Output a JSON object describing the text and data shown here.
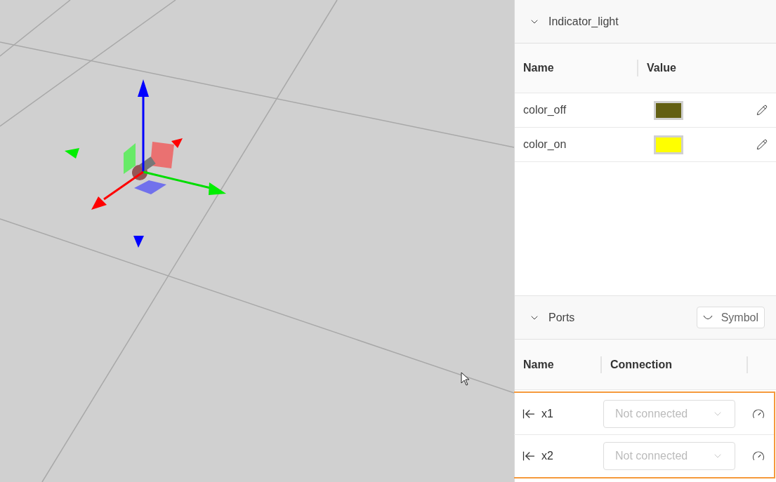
{
  "properties": {
    "title": "Indicator_light",
    "expanded": true,
    "columns": [
      "Name",
      "Value"
    ],
    "rows": [
      {
        "name": "color_off",
        "color": "#636013"
      },
      {
        "name": "color_on",
        "color": "#ffff00"
      }
    ]
  },
  "ports": {
    "title": "Ports",
    "expanded": true,
    "symbol_button": "Symbol",
    "columns": [
      "Name",
      "Connection"
    ],
    "highlighted": true,
    "rows": [
      {
        "name": "x1",
        "placeholder": "Not connected"
      },
      {
        "name": "x2",
        "placeholder": "Not connected"
      }
    ]
  }
}
